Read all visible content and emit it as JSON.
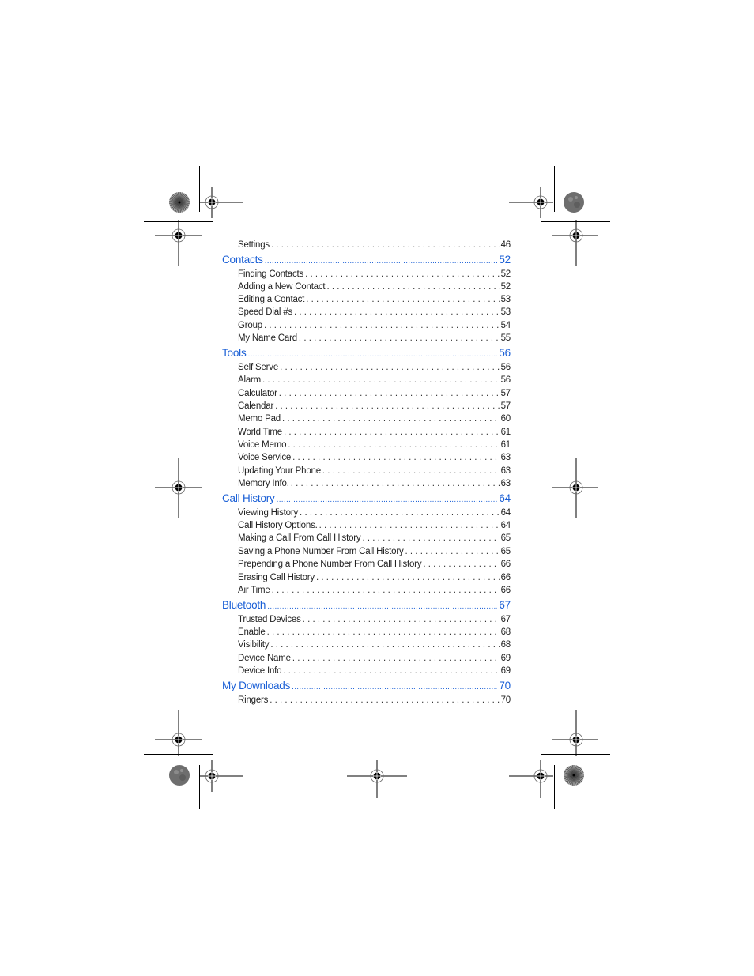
{
  "document": {
    "type": "table-of-contents",
    "entries": [
      {
        "level": "sub",
        "label": "Settings",
        "page": "46"
      },
      {
        "level": "section",
        "label": "Contacts",
        "page": "52"
      },
      {
        "level": "sub",
        "label": "Finding Contacts",
        "page": "52"
      },
      {
        "level": "sub",
        "label": "Adding a New Contact",
        "page": "52"
      },
      {
        "level": "sub",
        "label": "Editing a Contact",
        "page": "53"
      },
      {
        "level": "sub",
        "label": "Speed Dial #s",
        "page": "53"
      },
      {
        "level": "sub",
        "label": "Group",
        "page": "54"
      },
      {
        "level": "sub",
        "label": "My Name Card",
        "page": "55"
      },
      {
        "level": "section",
        "label": "Tools",
        "page": "56"
      },
      {
        "level": "sub",
        "label": "Self Serve",
        "page": "56"
      },
      {
        "level": "sub",
        "label": "Alarm",
        "page": "56"
      },
      {
        "level": "sub",
        "label": "Calculator",
        "page": "57"
      },
      {
        "level": "sub",
        "label": "Calendar",
        "page": "57"
      },
      {
        "level": "sub",
        "label": "Memo Pad",
        "page": "60"
      },
      {
        "level": "sub",
        "label": "World Time",
        "page": "61"
      },
      {
        "level": "sub",
        "label": "Voice Memo",
        "page": "61"
      },
      {
        "level": "sub",
        "label": "Voice Service",
        "page": "63"
      },
      {
        "level": "sub",
        "label": "Updating Your Phone",
        "page": "63"
      },
      {
        "level": "sub",
        "label": "Memory Info.",
        "page": "63"
      },
      {
        "level": "section",
        "label": "Call History",
        "page": "64"
      },
      {
        "level": "sub",
        "label": "Viewing History",
        "page": "64"
      },
      {
        "level": "sub",
        "label": "Call History Options.",
        "page": "64"
      },
      {
        "level": "sub",
        "label": "Making a Call From Call History",
        "page": "65"
      },
      {
        "level": "sub",
        "label": "Saving a Phone Number From Call History",
        "page": "65"
      },
      {
        "level": "sub",
        "label": "Prepending a Phone Number From Call History",
        "page": "66"
      },
      {
        "level": "sub",
        "label": "Erasing Call History",
        "page": "66"
      },
      {
        "level": "sub",
        "label": "Air Time",
        "page": "66"
      },
      {
        "level": "section",
        "label": "Bluetooth",
        "page": "67"
      },
      {
        "level": "sub",
        "label": "Trusted Devices",
        "page": "67"
      },
      {
        "level": "sub",
        "label": "Enable",
        "page": "68"
      },
      {
        "level": "sub",
        "label": "Visibility",
        "page": "68"
      },
      {
        "level": "sub",
        "label": "Device Name",
        "page": "69"
      },
      {
        "level": "sub",
        "label": "Device Info",
        "page": "69"
      },
      {
        "level": "section",
        "label": "My Downloads",
        "page": "70"
      },
      {
        "level": "sub",
        "label": "Ringers",
        "page": "70"
      }
    ]
  },
  "colors": {
    "section_link": "#1a5fd6",
    "body_text": "#222222"
  },
  "icons": {
    "registration_mark": "crosshair-target-icon",
    "color_bar": "starburst-disc-icon"
  }
}
